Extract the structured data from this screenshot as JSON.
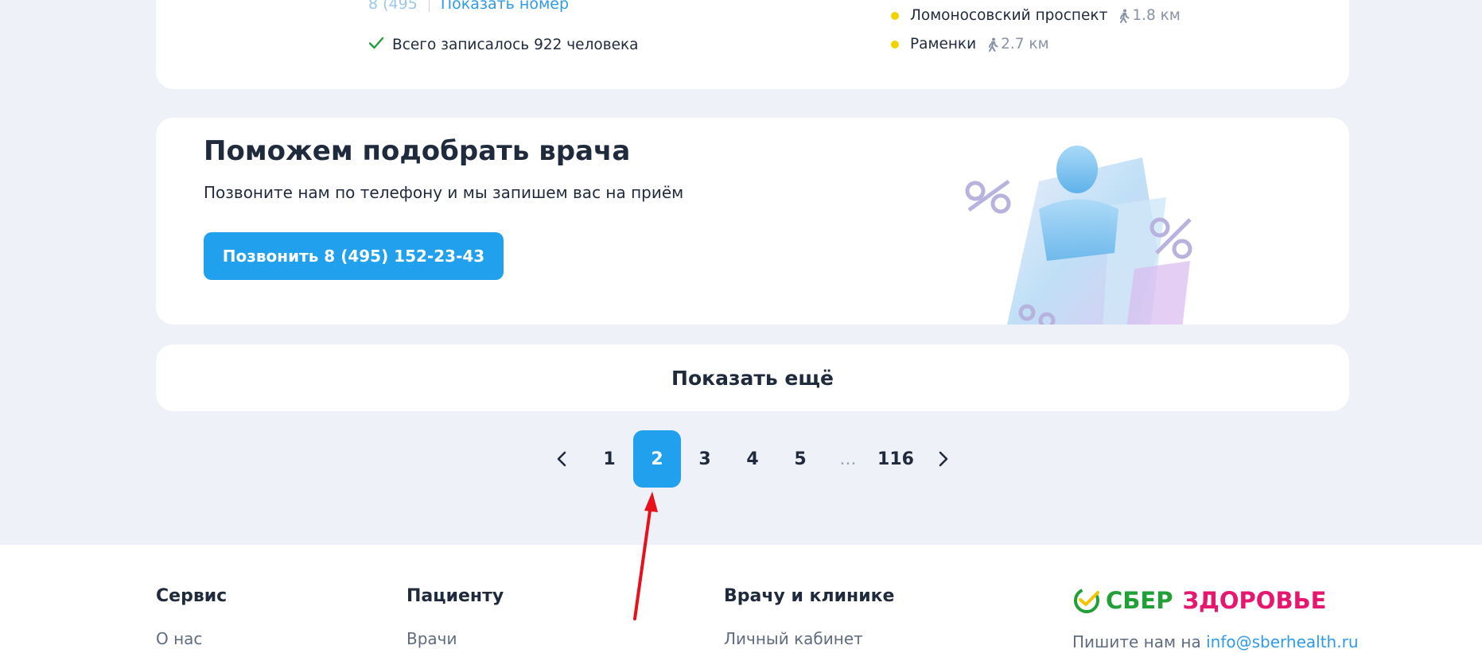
{
  "clinic_card": {
    "phone_partial": "8 (495",
    "show_number_label": "Показать номер",
    "booked_text": "Всего записалось 922 человека",
    "metro": [
      {
        "station": "Ломоносовский проспект",
        "distance": "1.8 км"
      },
      {
        "station": "Раменки",
        "distance": "2.7 км"
      }
    ]
  },
  "promo": {
    "title": "Поможем подобрать врача",
    "subtitle": "Позвоните нам по телефону и мы запишем вас на приём",
    "call_button": "Позвонить 8 (495) 152-23-43"
  },
  "show_more": "Показать ещё",
  "pagination": {
    "pages": [
      "1",
      "2",
      "3",
      "4",
      "5"
    ],
    "ellipsis": "...",
    "last_page": "116",
    "current": "2"
  },
  "footer": {
    "columns": [
      {
        "title": "Сервис",
        "link": "О нас"
      },
      {
        "title": "Пациенту",
        "link": "Врачи"
      },
      {
        "title": "Врачу и клинике",
        "link": "Личный кабинет"
      }
    ],
    "logo_sber": "СБЕР",
    "logo_health": "ЗДОРОВЬЕ",
    "contact_prefix": "Пишите нам на",
    "contact_email": "info@sberhealth.ru"
  },
  "colors": {
    "accent": "#21a0ed",
    "page_bg": "#eef1f8",
    "sber_green": "#21a038",
    "health_pink": "#e6176e",
    "annotation_arrow": "#e8101a"
  },
  "icons": [
    "check-icon",
    "metro-dot-icon",
    "walk-icon",
    "chevron-left-icon",
    "chevron-right-icon",
    "sber-logo-icon"
  ]
}
